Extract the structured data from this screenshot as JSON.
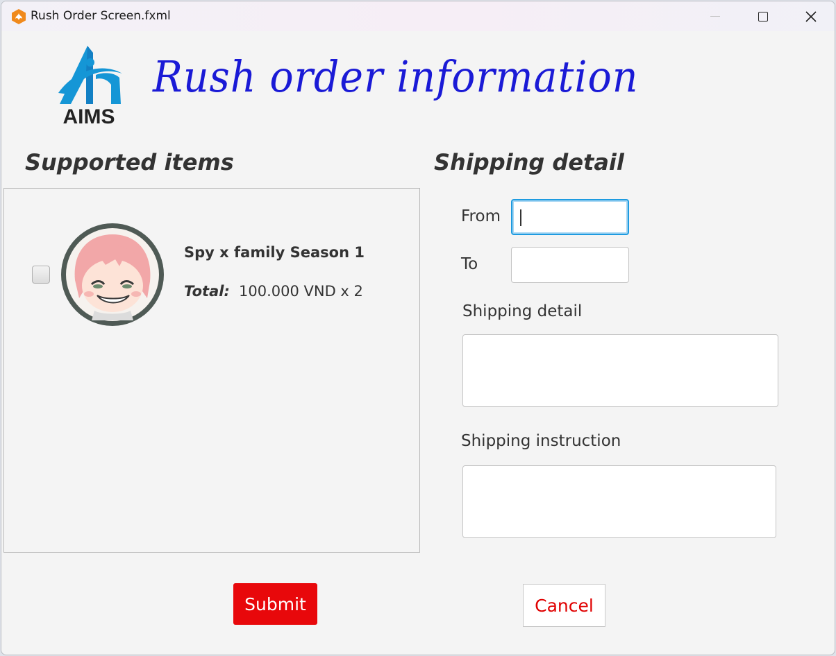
{
  "window": {
    "title": "Rush Order Screen.fxml",
    "icons": {
      "app": "app-flame-icon",
      "minimize": "minimize-icon",
      "maximize": "maximize-icon",
      "close": "close-icon"
    }
  },
  "header": {
    "logo_text": "AIMS",
    "title": "Rush order information"
  },
  "supported_items": {
    "title": "Supported items",
    "items": [
      {
        "name": "Spy x family Season 1",
        "total_label": "Total:",
        "total_value": "100.000 VND x 2",
        "checked": false
      }
    ]
  },
  "shipping": {
    "title": "Shipping detail",
    "from_label": "From",
    "from_value": "",
    "to_label": "To",
    "to_value": "",
    "detail_label": "Shipping detail",
    "detail_value": "",
    "instruction_label": "Shipping instruction",
    "instruction_value": ""
  },
  "actions": {
    "submit": "Submit",
    "cancel": "Cancel"
  },
  "colors": {
    "heading": "#1a1ad6",
    "submit_bg": "#e8080b",
    "cancel_text": "#e00000",
    "focus": "#1e9be0",
    "logo_blue": "#1596d6"
  }
}
